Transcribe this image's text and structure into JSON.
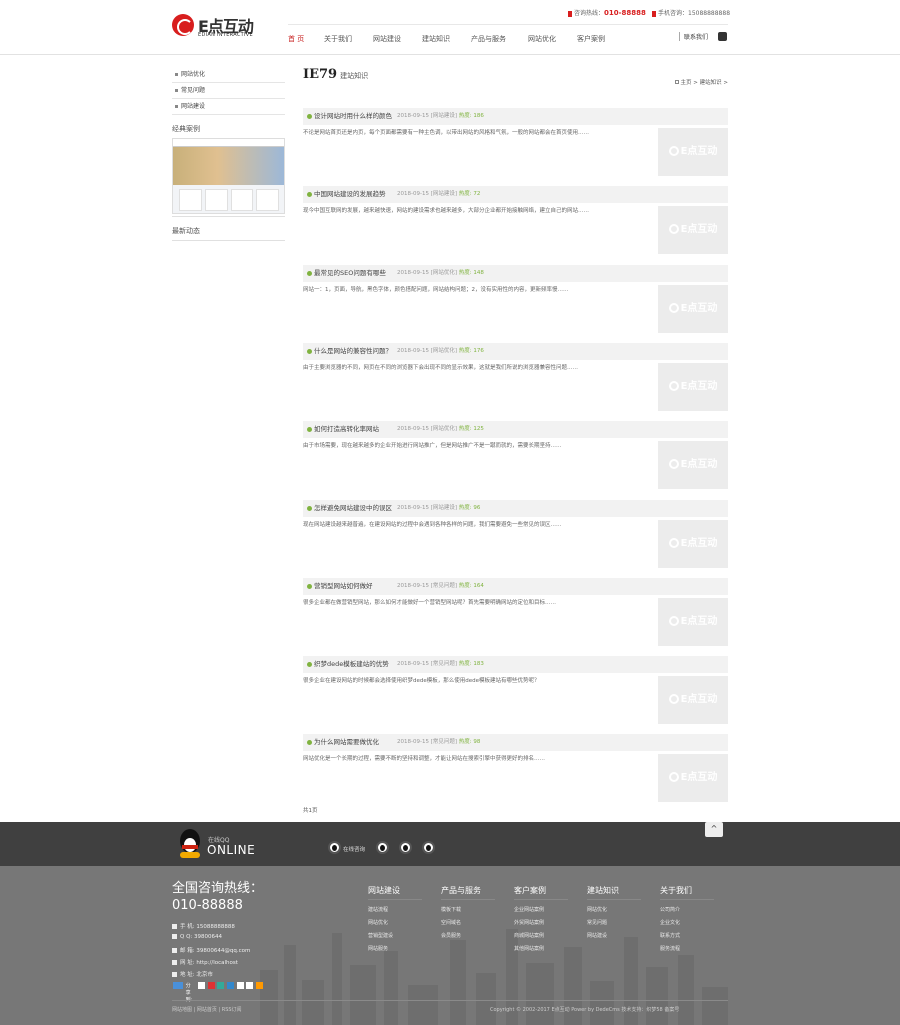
{
  "header": {
    "logo_cn": "E点互动",
    "logo_en": "EDIAN INTERACTIVE",
    "hotline_label": "咨询热线：",
    "hotline_number": "010-88888",
    "mobile_label": "手机咨询：",
    "mobile_number": "15088888888",
    "member_label": "联系我们"
  },
  "nav": [
    "首 页",
    "关于我们",
    "网站建设",
    "建站知识",
    "产品与服务",
    "网站优化",
    "客户案例"
  ],
  "sidebar": {
    "items": [
      "网站优化",
      "常见问题",
      "网站建设"
    ],
    "case_title": "经典案例",
    "news_title": "最新动态"
  },
  "main": {
    "title_en": "IE79",
    "title_cn": "建站知识",
    "breadcrumb": "主页 > 建站知识 >"
  },
  "articles": [
    {
      "title": "设计网站时用什么样的颜色",
      "date": "2018-09-15",
      "category": "[网站建设]",
      "views": "热度: 186",
      "desc": "不论是网站首页还是内页，每个页面都需要有一种主色调，以带出网站的风格和气氛，一般的网站都会在首页使用……"
    },
    {
      "title": "中国网站建设的发展趋势",
      "date": "2018-09-15",
      "category": "[网站建设]",
      "views": "热度: 72",
      "desc": "现今中国互联网的发展，越来越快速，网站的建设需求也越来越多，大部分企业都开始接触网络，建立自己的网站……"
    },
    {
      "title": "最常见的SEO问题有哪些",
      "date": "2018-09-15",
      "category": "[网站优化]",
      "views": "热度: 148",
      "desc": "网站一：1，页面，导航，黑色字体，颜色搭配问题，网站结构问题；2，没有实用性的内容，更新频率慢……"
    },
    {
      "title": "什么是网站的兼容性问题？",
      "date": "2018-09-15",
      "category": "[网站优化]",
      "views": "热度: 176",
      "desc": "由于主要浏览器的不同，网页在不同的浏览器下会出现不同的显示效果，这就是我们所说的浏览器兼容性问题……"
    },
    {
      "title": "如何打造高转化率网站",
      "date": "2018-09-15",
      "category": "[网站优化]",
      "views": "热度: 125",
      "desc": "由于市场需要，现在越来越多的企业开始进行网站推广，但是网站推广不是一蹴而就的，需要长期坚持……"
    },
    {
      "title": "怎样避免网站建设中的误区",
      "date": "2018-09-15",
      "category": "[网站建设]",
      "views": "热度: 96",
      "desc": "现在网站建设越来越普遍，在建设网站的过程中会遇到各种各样的问题，我们需要避免一些常见的误区……"
    },
    {
      "title": "营销型网站如何做好",
      "date": "2018-09-15",
      "category": "[常见问题]",
      "views": "热度: 164",
      "desc": "很多企业都在做营销型网站，那么如何才能做好一个营销型网站呢？首先需要明确网站的定位和目标……"
    },
    {
      "title": "织梦dede模板建站的优势",
      "date": "2018-09-15",
      "category": "[常见问题]",
      "views": "热度: 183",
      "desc": "很多企业在建设网站的时候都会选择使用织梦dede模板，那么使用dede模板建站有哪些优势呢？"
    },
    {
      "title": "为什么网站需要做优化",
      "date": "2018-09-15",
      "category": "[常见问题]",
      "views": "热度: 98",
      "desc": "网站优化是一个长期的过程，需要不断的坚持和调整，才能让网站在搜索引擎中获得更好的排名……"
    }
  ],
  "thumb_text": "E点互动",
  "total_text": "共1页",
  "online": {
    "sub": "在线QQ",
    "label": "ONLINE",
    "qq_label": "在线咨询",
    "gotop": "^"
  },
  "footer": {
    "hotline_label": "全国咨询热线：",
    "hotline_number": "010-88888",
    "phone": "手 机: 15088888888",
    "qq": "Q Q: 39800644",
    "email": "邮 箱: 39800644@qq.com",
    "site": "网 址: http://localhost",
    "address": "地 址: 北京市",
    "share_label": "分享到:",
    "columns": [
      {
        "title": "网站建设",
        "links": [
          "建站流程",
          "网站优化",
          "营销型建设",
          "网站服务"
        ]
      },
      {
        "title": "产品与服务",
        "links": [
          "模板下载",
          "空间域名",
          "会员服务"
        ]
      },
      {
        "title": "客户案例",
        "links": [
          "企业网站案例",
          "外贸网站案例",
          "商城网站案例",
          "其他网站案例"
        ]
      },
      {
        "title": "建站知识",
        "links": [
          "网站优化",
          "常见问题",
          "网站建设"
        ]
      },
      {
        "title": "关于我们",
        "links": [
          "公司简介",
          "企业文化",
          "联系方式",
          "服务流程"
        ]
      }
    ],
    "copy_left": "网站地图 | 网站首页 | RSS订阅",
    "copy_right": "Copyright © 2002-2017 E点互动 Power by DedeCms  技术支持：织梦58  备案号"
  },
  "colors": {
    "accent_red": "#d81e1e",
    "green": "#80b340",
    "online_bar": "#404040",
    "footer_bg": "#777777"
  }
}
